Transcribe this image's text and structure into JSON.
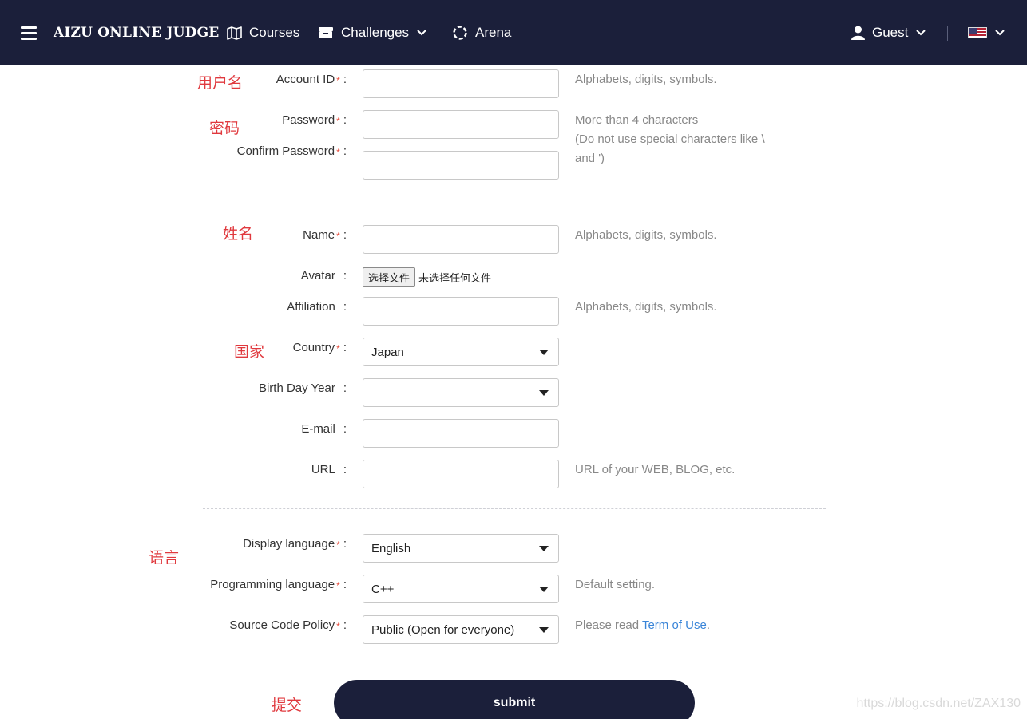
{
  "nav": {
    "brand": "AIZU ONLINE JUDGE",
    "courses": "Courses",
    "challenges": "Challenges",
    "arena": "Arena",
    "user": "Guest"
  },
  "form": {
    "account_id": {
      "label": "Account ID",
      "hint": "Alphabets, digits, symbols."
    },
    "password": {
      "label": "Password",
      "hint": [
        "More than 4 characters",
        "(Do not use special characters like \\",
        "and ')"
      ]
    },
    "confirm_password": {
      "label": "Confirm Password"
    },
    "name": {
      "label": "Name",
      "hint": "Alphabets, digits, symbols."
    },
    "avatar": {
      "label": "Avatar",
      "button": "选择文件",
      "status": "未选择任何文件"
    },
    "affiliation": {
      "label": "Affiliation",
      "hint": "Alphabets, digits, symbols."
    },
    "country": {
      "label": "Country",
      "value": "Japan"
    },
    "birth_year": {
      "label": "Birth Day Year",
      "value": ""
    },
    "email": {
      "label": "E-mail"
    },
    "url": {
      "label": "URL",
      "hint": "URL of your WEB, BLOG, etc."
    },
    "display_language": {
      "label": "Display language",
      "value": "English"
    },
    "programming_language": {
      "label": "Programming language",
      "value": "C++",
      "hint": "Default setting."
    },
    "source_code_policy": {
      "label": "Source Code Policy",
      "value": "Public (Open for everyone)",
      "hint_prefix": "Please read ",
      "hint_link": "Term of Use",
      "hint_suffix": "."
    },
    "submit": "submit"
  },
  "annotations": {
    "username": "用户名",
    "password": "密码",
    "name": "姓名",
    "country": "国家",
    "language": "语言",
    "submit": "提交"
  },
  "watermark": "https://blog.csdn.net/ZAX130",
  "colors": {
    "navbar": "#1b1f3a",
    "required": "#e74c3c",
    "annotation": "#e0393e",
    "link": "#3a85d8"
  }
}
